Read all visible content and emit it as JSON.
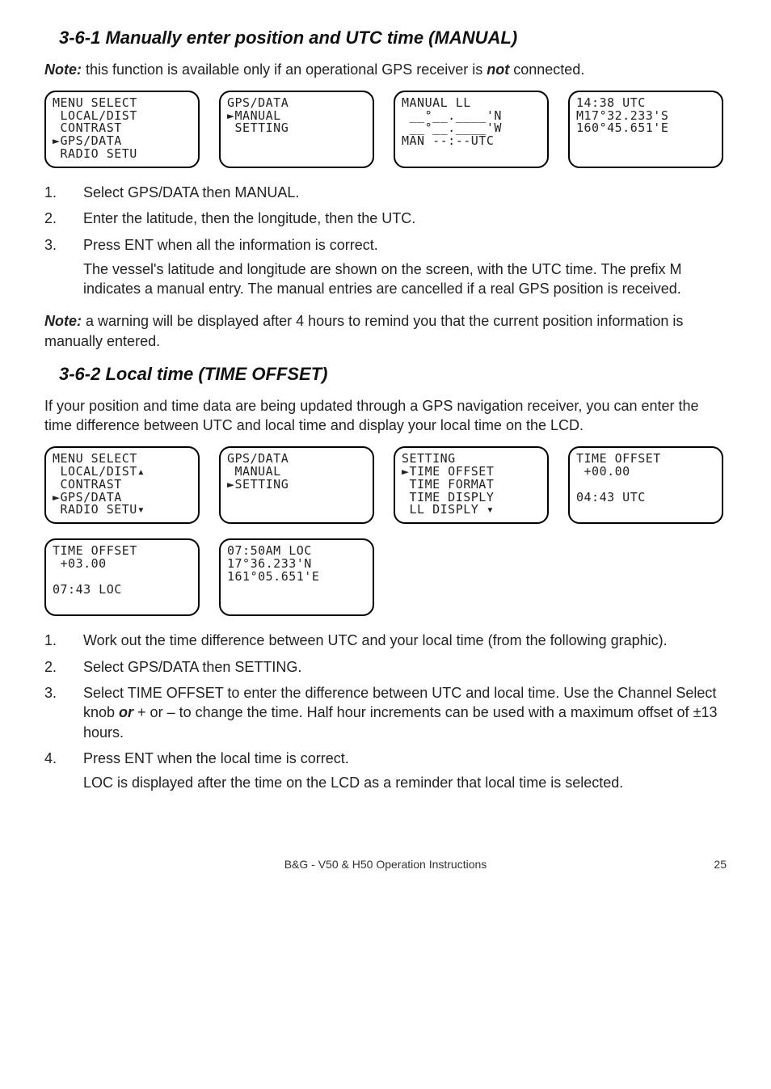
{
  "s361": {
    "title": "3-6-1 Manually enter position and UTC time (MANUAL)",
    "note_label": "Note:",
    "note_text_1": " this function is available only if an operational GPS receiver is ",
    "note_emph": "not",
    "note_text_2": " connected.",
    "lcd": [
      "MENU SELECT\n LOCAL/DIST\n CONTRAST\n►GPS/DATA\n RADIO SETU",
      "GPS/DATA\n►MANUAL\n SETTING",
      "MANUAL LL\n __°__.____'N\n __°__.____'W\nMAN --:--UTC",
      "14:38 UTC\nM17°32.233'S\n160°45.651'E"
    ],
    "steps": [
      "Select GPS/DATA then MANUAL.",
      "Enter the latitude, then the longitude, then the UTC.",
      "Press ENT when all the information is correct."
    ],
    "step3_sub": "The vessel's latitude and longitude are shown on the screen, with the UTC time. The prefix M indicates a manual entry. The manual entries are cancelled if a real GPS position is received.",
    "note2_label": "Note:",
    "note2_text": " a warning will be displayed after 4 hours to remind you that the current position information is manually entered."
  },
  "s362": {
    "title": "3-6-2 Local time (TIME OFFSET)",
    "intro": "If your position and time data are being updated through a GPS navigation receiver, you can enter the time difference between UTC and local time and display your local time on the LCD.",
    "lcd_row1": [
      "MENU SELECT\n LOCAL/DIST▴\n CONTRAST\n►GPS/DATA\n RADIO SETU▾",
      "GPS/DATA\n MANUAL\n►SETTING",
      "SETTING\n►TIME OFFSET\n TIME FORMAT\n TIME DISPLY\n LL DISPLY ▾",
      "TIME OFFSET\n +00.00\n\n04:43 UTC"
    ],
    "lcd_row2": [
      "TIME OFFSET\n +03.00\n\n07:43 LOC",
      "07:50AM LOC\n17°36.233'N\n161°05.651'E"
    ],
    "steps": {
      "s1": "Work out the time difference between UTC and your local time (from the following graphic).",
      "s2": "Select GPS/DATA then SETTING.",
      "s3a": "Select TIME OFFSET to enter the difference between UTC and local time. Use the Channel Select knob ",
      "s3or": "or",
      "s3b": " + or – to change the time. Half hour increments can be used with a maximum offset of ±13 hours.",
      "s4": "Press ENT when the local time is correct.",
      "s4sub": "LOC is displayed after the time on the LCD as a reminder that local time is selected."
    }
  },
  "footer": {
    "center": "B&G - V50 & H50 Operation Instructions",
    "page": "25"
  }
}
